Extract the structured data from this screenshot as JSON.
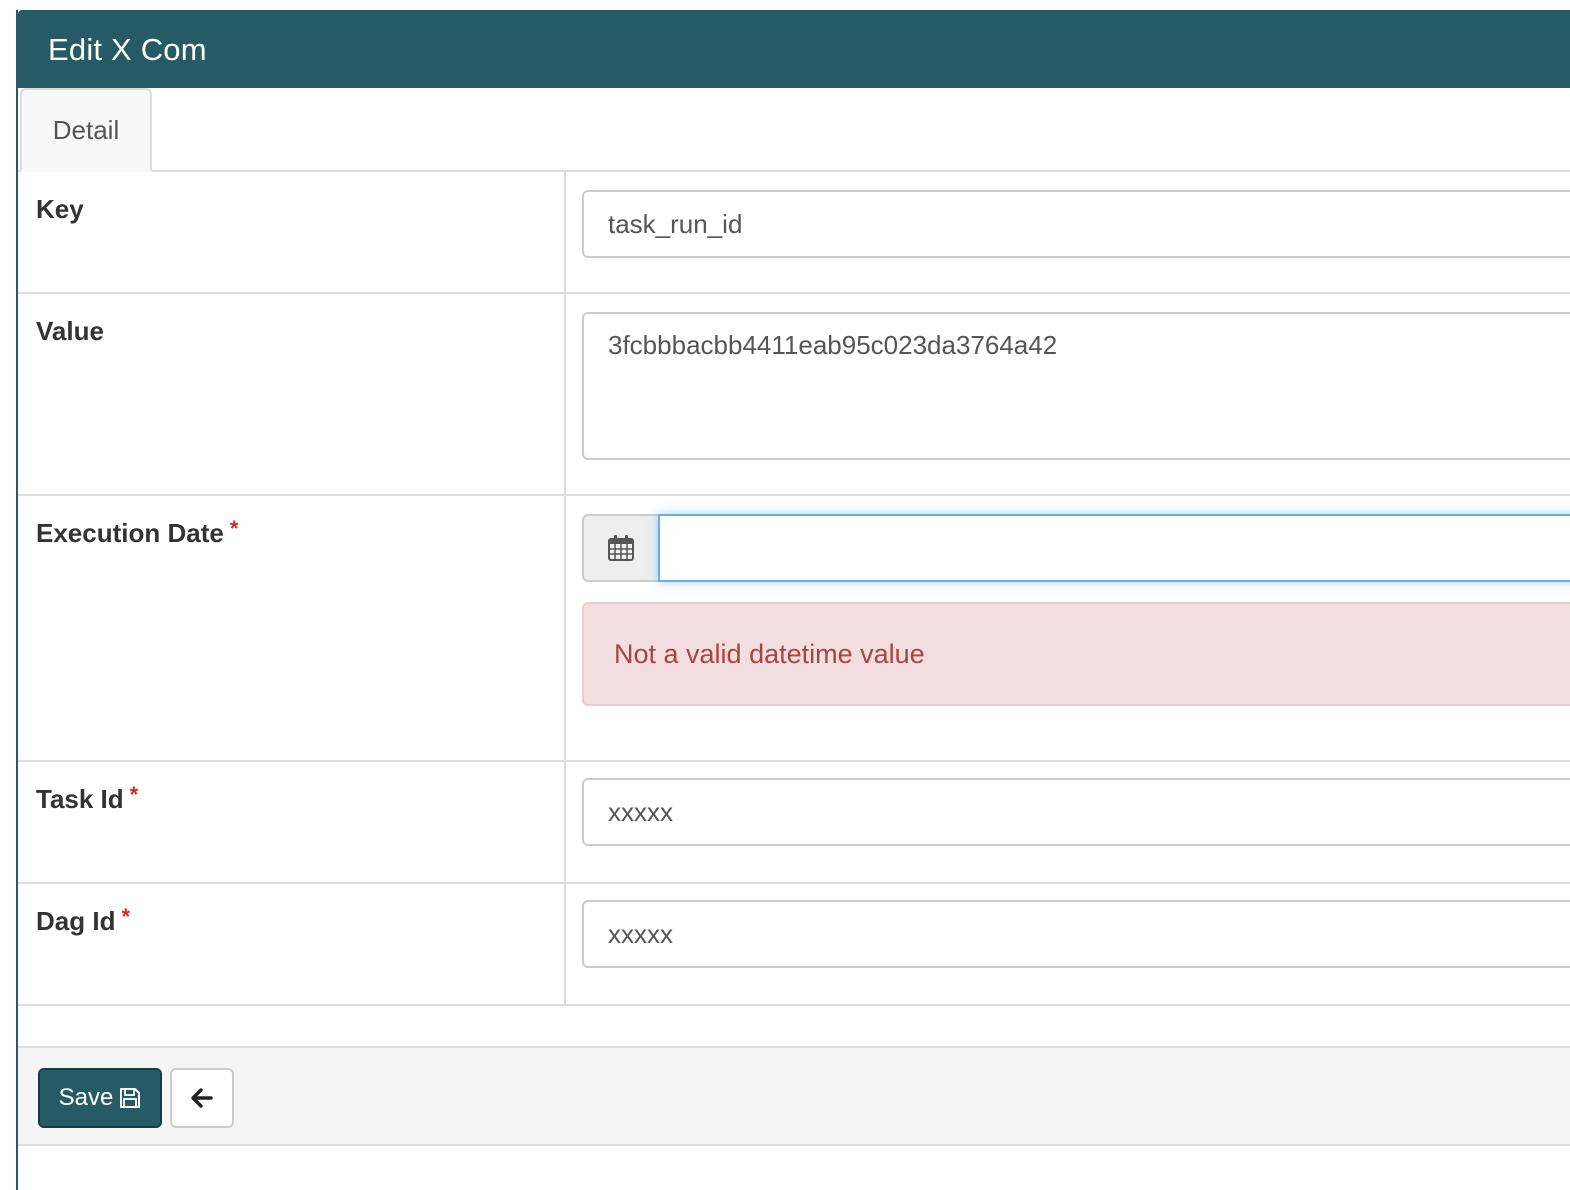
{
  "header": {
    "title": "Edit X Com"
  },
  "tabs": [
    {
      "label": "Detail"
    }
  ],
  "fields": {
    "key": {
      "label": "Key",
      "value": "task_run_id"
    },
    "value": {
      "label": "Value",
      "value": "3fcbbbacbb4411eab95c023da3764a42"
    },
    "execution_date": {
      "label": "Execution Date",
      "required_mark": "*",
      "value": "",
      "error": "Not a valid datetime value"
    },
    "task_id": {
      "label": "Task Id",
      "required_mark": "*",
      "value": "xxxxx"
    },
    "dag_id": {
      "label": "Dag Id",
      "required_mark": "*",
      "value": "xxxxx"
    }
  },
  "footer": {
    "save_label": "Save"
  },
  "icons": {
    "calendar": "calendar-icon",
    "save": "floppy-disk-icon",
    "back": "arrow-left-icon"
  },
  "colors": {
    "primary": "#265b66",
    "required": "#d9291c",
    "error_bg": "#f2dede",
    "error_text": "#a94442",
    "focus_border": "#66afe9"
  }
}
